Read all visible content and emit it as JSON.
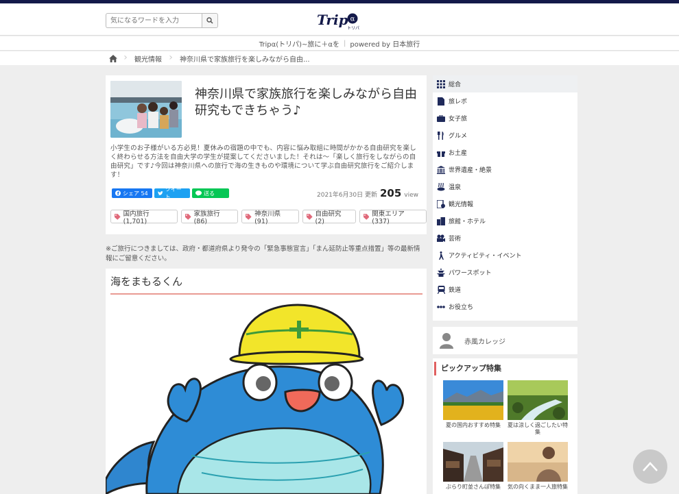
{
  "header": {
    "search_placeholder": "気になるワードを入力",
    "logo_text": "Trip",
    "logo_sub": "トリパ",
    "tagline": "Tripα(トリパ)~旅に＋αを",
    "powered": "powered by 日本旅行"
  },
  "breadcrumb": {
    "items": [
      "観光情報",
      "神奈川県で家族旅行を楽しみながら自由..."
    ]
  },
  "article": {
    "title": "神奈川県で家族旅行を楽しみながら自由研究もできちゃう♪",
    "lead": "小学生のお子様がいる方必見！夏休みの宿題の中でも、内容に悩み取組に時間がかかる自由研究を楽しく終わらせる方法を自由大学の学生が提案してくださいました！それは～「楽しく旅行をしながらの自由研究」です♪今回は神奈川県への旅行で海の生きものや環境について学ぶ自由研究旅行をご紹介します！",
    "share": {
      "facebook": "シェア 54",
      "twitter": "ツイート",
      "line": "送る"
    },
    "date": "2021年6月30日 更新",
    "views": "205",
    "views_unit": "view",
    "tags": [
      "国内旅行 (1,701)",
      "家族旅行 (86)",
      "神奈川県 (91)",
      "自由研究 (2)",
      "関東エリア (337)"
    ]
  },
  "notice": "※ご旅行につきましては、政府・都道府県より発令の「緊急事態宣言」「まん延防止等重点措置」等の最新情報にご留意ください。",
  "section": {
    "title": "海をまもるくん"
  },
  "sidebar": {
    "items": [
      {
        "label": "総合",
        "icon": "grid-icon"
      },
      {
        "label": "旅レポ",
        "icon": "document-icon"
      },
      {
        "label": "女子旅",
        "icon": "suitcase-icon"
      },
      {
        "label": "グルメ",
        "icon": "fork-knife-icon"
      },
      {
        "label": "お土産",
        "icon": "gift-icon"
      },
      {
        "label": "世界遺産・絶景",
        "icon": "temple-icon"
      },
      {
        "label": "温泉",
        "icon": "hot-spring-icon"
      },
      {
        "label": "観光情報",
        "icon": "info-doc-icon"
      },
      {
        "label": "旅館・ホテル",
        "icon": "building-icon"
      },
      {
        "label": "芸術",
        "icon": "film-icon"
      },
      {
        "label": "アクティビティ・イベント",
        "icon": "hiker-icon"
      },
      {
        "label": "パワースポット",
        "icon": "pagoda-icon"
      },
      {
        "label": "鉄道",
        "icon": "train-icon"
      },
      {
        "label": "お役立ち",
        "icon": "dots-icon"
      }
    ]
  },
  "author": {
    "name": "赤風カレッジ"
  },
  "pickup": {
    "title": "ピックアップ特集",
    "items": [
      "夏の国内おすすめ特集",
      "夏は涼しく過ごしたい特集",
      "ぶらり町並さんぽ特集",
      "気の向くまま一人旅特集"
    ]
  },
  "colors": {
    "accent": "#141a4a",
    "tag_icon": "#e0697a",
    "section_border": "#e99a92"
  }
}
